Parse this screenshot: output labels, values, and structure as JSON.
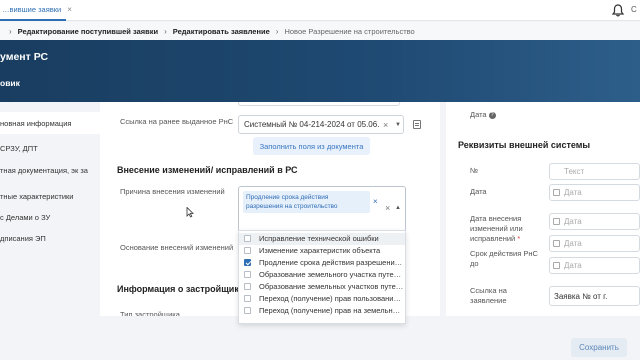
{
  "tab": {
    "label": "…вившие заявки",
    "close": "×"
  },
  "user": {
    "initial": "С"
  },
  "breadcrumb": [
    "Редактирование поступившей заявки",
    "Редактировать заявление",
    "Новое Разрешение на строительство"
  ],
  "header": {
    "title": "умент РС",
    "subtitle": "овик"
  },
  "leftnav": [
    "новная информация",
    "СРЗУ, ДПТ",
    "тная документация, эк за",
    "тные характеристики",
    "с Делами о ЗУ",
    "дписания ЭП"
  ],
  "form": {
    "prev_link_label": "Ссылка на ранее выданное РнС",
    "prev_link_value": "Системный № 04-214-2024 от 05.06....",
    "fill_button": "Заполнить поля из документа",
    "changes_section": "Внесение изменений/ исправлений в РС",
    "reason_label": "Причина внесения изменений",
    "reason_tag": "Продление срока действия разрешения на строительство",
    "basis_label": "Основание внесений изменений",
    "developer_section": "Информация о застройщике",
    "developer_type_label": "Тип застройщика"
  },
  "dropdown_options": [
    {
      "label": "Исправление технической ошибки",
      "checked": false
    },
    {
      "label": "Изменение характеристик объекта",
      "checked": false
    },
    {
      "label": "Продление срока действия разрешения на...",
      "checked": true
    },
    {
      "label": "Образование земельного участка путем об...",
      "checked": false
    },
    {
      "label": "Образование земельных участков путем р...",
      "checked": false
    },
    {
      "label": "Переход (получение) прав пользования не...",
      "checked": false
    },
    {
      "label": "Переход (получение) прав на земельный у...",
      "checked": false
    }
  ],
  "right": {
    "date_label": "Дата",
    "external_title": "Реквизиты внешней системы",
    "num_label": "№",
    "num_placeholder": "Текст",
    "date2_label": "Дата",
    "date_placeholder": "Дата",
    "change_date_label": "Дата внесения изменений или исправлений",
    "validity_label": "Срок действия РнС до",
    "request_link_label": "Ссылка на заявление",
    "request_link_value": "Заявка № от г."
  },
  "save_button": "Сохранить",
  "colors": {
    "header": "#1f4a73",
    "accent": "#2f6fb5"
  }
}
